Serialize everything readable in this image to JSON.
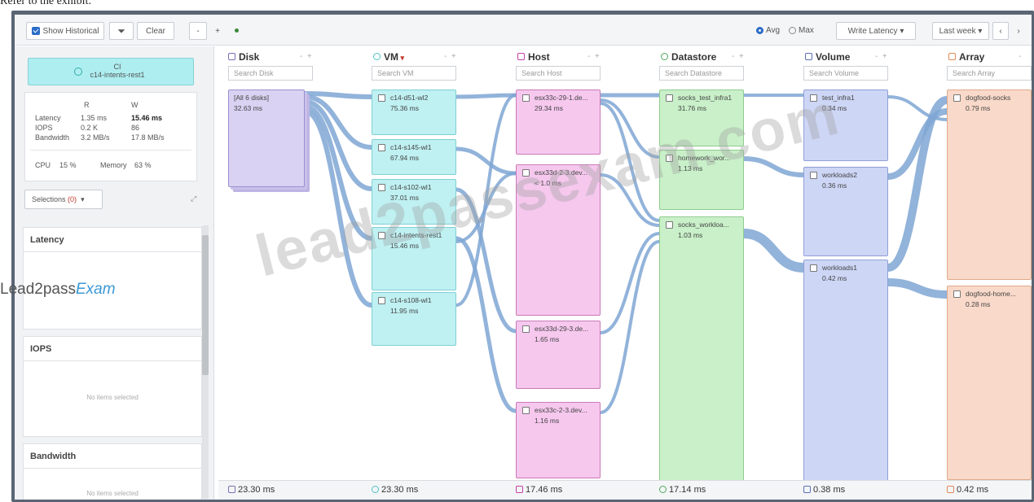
{
  "caption": "Refer to the exhibit.",
  "toolbar": {
    "show_historical": "Show Historical",
    "clear": "Clear",
    "zoom_out": "-",
    "zoom_in": "+",
    "avg": "Avg",
    "max": "Max",
    "metric": "Write Latency",
    "range": "Last week"
  },
  "left": {
    "card_line1": "CI",
    "card_line2": "c14-intents-rest1",
    "col_r": "R",
    "col_w": "W",
    "rows": [
      {
        "label": "Latency",
        "r": "1.35 ms",
        "w": "15.46 ms"
      },
      {
        "label": "IOPS",
        "r": "0.2 K",
        "w": "86"
      },
      {
        "label": "Bandwidth",
        "r": "3.2 MB/s",
        "w": "17.8 MB/s"
      }
    ],
    "cpu_label": "CPU",
    "cpu_val": "15 %",
    "mem_label": "Memory",
    "mem_val": "63 %",
    "selections": "Selections",
    "selections_count": "(0)",
    "sections": [
      {
        "title": "Latency",
        "empty": ""
      },
      {
        "title": "IOPS",
        "empty": "No items selected"
      },
      {
        "title": "Bandwidth",
        "empty": "No items selected"
      }
    ],
    "logo_a": "Lead2pass",
    "logo_b": "Exam"
  },
  "columns": [
    {
      "title": "Disk",
      "search": "Search Disk",
      "footer": "23.30 ms",
      "color": "#7a6fb5"
    },
    {
      "title": "VM",
      "search": "Search VM",
      "footer": "23.30 ms",
      "color": "#4fc4c9"
    },
    {
      "title": "Host",
      "search": "Search Host",
      "footer": "17.46 ms",
      "color": "#c63fa9"
    },
    {
      "title": "Datastore",
      "search": "Search Datastore",
      "footer": "17.14 ms",
      "color": "#4fa85a"
    },
    {
      "title": "Volume",
      "search": "Search Volume",
      "footer": "0.38 ms",
      "color": "#5a6fb8"
    },
    {
      "title": "Array",
      "search": "Search Array",
      "footer": "0.42 ms",
      "color": "#e08a5a"
    }
  ],
  "nodes": {
    "disk": [
      {
        "label": "[All 6 disks]",
        "value": "32.63 ms"
      }
    ],
    "vm": [
      {
        "label": "c14-d51-wl2",
        "value": "75.36 ms"
      },
      {
        "label": "c14-s145-wl1",
        "value": "67.94 ms"
      },
      {
        "label": "c14-s102-wl1",
        "value": "37.01 ms"
      },
      {
        "label": "c14-intents-rest1",
        "value": "15.46 ms"
      },
      {
        "label": "c14-s108-wl1",
        "value": "11.95 ms"
      }
    ],
    "host": [
      {
        "label": "esx33c-29-1.de...",
        "value": "29.34 ms"
      },
      {
        "label": "esx33d-2-3.dev...",
        "value": "< 1.0 ms"
      },
      {
        "label": "esx33d-29-3.de...",
        "value": "1.65 ms"
      },
      {
        "label": "esx33c-2-3.dev...",
        "value": "1.16 ms"
      }
    ],
    "datastore": [
      {
        "label": "socks_test_infra1",
        "value": "31.76 ms"
      },
      {
        "label": "homework_wor...",
        "value": "1.13 ms"
      },
      {
        "label": "socks_workloa...",
        "value": "1.03 ms"
      }
    ],
    "volume": [
      {
        "label": "test_infra1",
        "value": "0.34 ms"
      },
      {
        "label": "workloads2",
        "value": "0.36 ms"
      },
      {
        "label": "workloads1",
        "value": "0.42 ms"
      }
    ],
    "array": [
      {
        "label": "dogfood-socks",
        "value": "0.79 ms"
      },
      {
        "label": "dogfood-home...",
        "value": "0.28 ms"
      }
    ]
  },
  "watermark": "lead2passexam.com"
}
